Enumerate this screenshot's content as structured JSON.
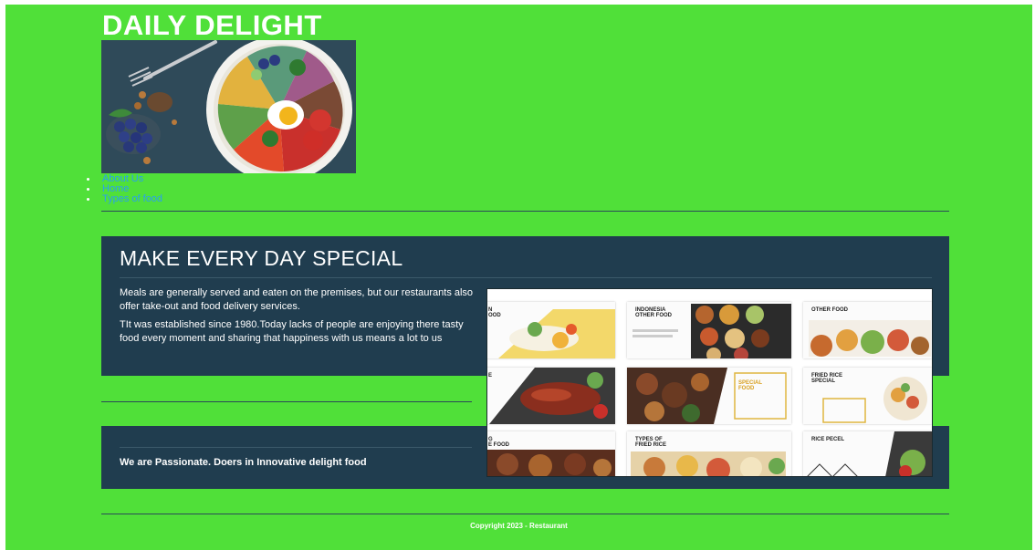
{
  "header": {
    "title": "DAILY DELIGHT",
    "hero_image": "salad-bowl-photo"
  },
  "nav": {
    "items": [
      {
        "label": "About Us"
      },
      {
        "label": "Home"
      },
      {
        "label": "Types of food"
      }
    ]
  },
  "main": {
    "heading": "MAKE EVERY DAY SPECIAL",
    "paragraphs": [
      "Meals are generally served and eaten on the premises, but our restaurants also offer take-out and food delivery services.",
      "TIt was established since 1980.Today lacks of people are enjoying there tasty food every moment and sharing that happiness with us means a lot to us"
    ],
    "tagline": "We are Passionate. Doers in Innovative delight food",
    "collage_image": "food-menu-collage",
    "collage_tiles": [
      {
        "label": "N\nOOD"
      },
      {
        "label": "INDONESIA\nOTHER FOOD"
      },
      {
        "label": "OTHER FOOD"
      },
      {
        "label": "E"
      },
      {
        "label": "SPECIAL\nFOOD"
      },
      {
        "label": "FRIED RICE\nSPECIAL"
      },
      {
        "label": "G\nE FOOD"
      },
      {
        "label": "TYPES OF\nFRIED RICE"
      },
      {
        "label": "RICE PECEL"
      }
    ]
  },
  "footer": {
    "copyright": "Copyright 2023 - Restaurant"
  },
  "colors": {
    "page_background": "#50e039",
    "panel": "#203d4f",
    "nav_link": "#2a9ff0",
    "text": "#ffffff"
  }
}
